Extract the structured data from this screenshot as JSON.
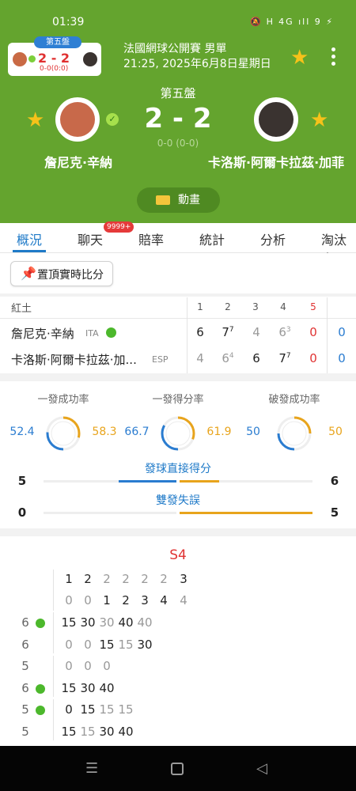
{
  "status": {
    "time": "01:39",
    "icons": "🔕 Ꮋ 4G ıll 9 ⚡"
  },
  "mini": {
    "set_label": "第五盤",
    "score": "2 - 2",
    "games": "0-0(0:0)"
  },
  "tournament": {
    "title": "法國網球公開賽 男單",
    "datetime": "21:25, 2025年6月8日星期日"
  },
  "match": {
    "set_label": "第五盤",
    "score": "2 - 2",
    "game_score": "0-0 (0-0)",
    "player1": {
      "name": "詹尼克·辛納",
      "short": "詹尼克·辛納",
      "country": "ITA"
    },
    "player2": {
      "name": "卡洛斯·阿爾卡拉茲·加菲",
      "short": "卡洛斯·阿爾卡拉茲·加...",
      "country": "ESP"
    },
    "animation_label": "動畫"
  },
  "tabs": [
    {
      "label": "概況"
    },
    {
      "label": "聊天",
      "badge": "9999+"
    },
    {
      "label": "賠率"
    },
    {
      "label": "統計"
    },
    {
      "label": "分析"
    },
    {
      "label": "淘汰賽"
    }
  ],
  "pin_label": "置頂實時比分",
  "scoreboard": {
    "court": "紅土",
    "set_headers": [
      "1",
      "2",
      "3",
      "4",
      "5"
    ],
    "p1_sets": [
      {
        "v": "6",
        "sup": ""
      },
      {
        "v": "7",
        "sup": "7"
      },
      {
        "v": "4",
        "sup": ""
      },
      {
        "v": "6",
        "sup": "3"
      },
      {
        "v": "0",
        "sup": ""
      }
    ],
    "p2_sets": [
      {
        "v": "4",
        "sup": ""
      },
      {
        "v": "6",
        "sup": "4"
      },
      {
        "v": "6",
        "sup": ""
      },
      {
        "v": "7",
        "sup": "7"
      },
      {
        "v": "0",
        "sup": ""
      }
    ],
    "p1_game": "0",
    "p2_game": "0"
  },
  "stats": {
    "circles": [
      {
        "label": "一發成功率",
        "p1": "52.4",
        "p2": "58.3"
      },
      {
        "label": "一發得分率",
        "p1": "66.7",
        "p2": "61.9"
      },
      {
        "label": "破發成功率",
        "p1": "50",
        "p2": "50"
      }
    ],
    "bars": [
      {
        "label": "發球直接得分",
        "p1": "5",
        "p2": "6"
      },
      {
        "label": "雙發失誤",
        "p1": "0",
        "p2": "5"
      }
    ]
  },
  "pbp": {
    "set_title": "S4",
    "header_top": [
      "1",
      "2",
      "2",
      "2",
      "2",
      "2",
      "3"
    ],
    "header_bottom": [
      "0",
      "0",
      "1",
      "2",
      "3",
      "4",
      "4"
    ],
    "games": [
      {
        "top_count": "6",
        "bottom_count": "6",
        "server": "top",
        "top": [
          "15",
          "30",
          "30",
          "40",
          "40"
        ],
        "bottom": [
          "0",
          "0",
          "15",
          "15",
          "30"
        ]
      },
      {
        "top_count": "5",
        "bottom_count": "6",
        "server": "bottom",
        "top": [
          "0",
          "0",
          "0"
        ],
        "bottom": [
          "15",
          "30",
          "40"
        ]
      },
      {
        "top_count": "5",
        "bottom_count": "5",
        "server": "top",
        "top": [
          "0",
          "15",
          "15",
          "15"
        ],
        "bottom": [
          "15",
          "15",
          "30",
          "40"
        ]
      }
    ]
  },
  "colors": {
    "header": "#64a42e",
    "accent": "#1f7ac8",
    "p1": "#2a7cd0",
    "p2": "#e8a41c",
    "red": "#e03333"
  }
}
